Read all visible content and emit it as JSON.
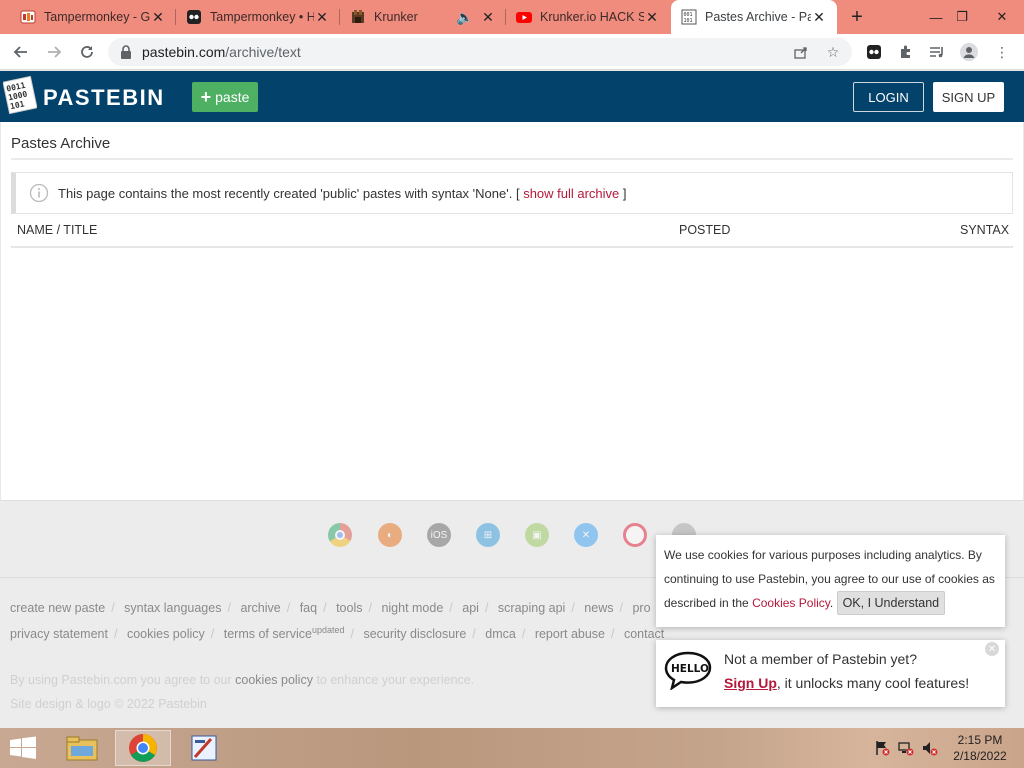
{
  "browser": {
    "tabs": [
      {
        "title": "Tampermonkey - G",
        "icon": "tampermonkey-icon",
        "active": false
      },
      {
        "title": "Tampermonkey • H",
        "icon": "tampermonkey-icon",
        "active": false
      },
      {
        "title": "Krunker",
        "icon": "krunker-icon",
        "active": false,
        "audio": true
      },
      {
        "title": "Krunker.io HACK S",
        "icon": "youtube-icon",
        "active": false
      },
      {
        "title": "Pastes Archive - Pa",
        "icon": "pastebin-icon",
        "active": true
      }
    ],
    "url_host": "pastebin.com",
    "url_path": "/archive/text"
  },
  "header": {
    "brand": "PASTEBIN",
    "paste_label": "paste",
    "login_label": "LOGIN",
    "signup_label": "SIGN UP"
  },
  "main": {
    "title": "Pastes Archive",
    "notice_text": "This page contains the most recently created 'public' pastes with syntax 'None'. [",
    "notice_link": "show full archive",
    "notice_end": "]",
    "columns": [
      "NAME / TITLE",
      "POSTED",
      "SYNTAX"
    ]
  },
  "footer": {
    "app_icons": [
      "chrome-icon",
      "firefox-icon",
      "ios-icon",
      "windows-icon",
      "android-icon",
      "mac-icon",
      "opera-icon",
      "other-icon"
    ],
    "links_row1": [
      "create new paste",
      "syntax languages",
      "archive",
      "faq",
      "tools",
      "night mode",
      "api",
      "scraping api",
      "news",
      "pro"
    ],
    "links_row2": [
      "privacy statement",
      "cookies policy",
      "terms of service",
      "security disclosure",
      "dmca",
      "report abuse",
      "contact"
    ],
    "tos_sup": "updated",
    "legal_prefix": "By using Pastebin.com you agree to our",
    "legal_link": "cookies policy",
    "legal_suffix": "to enhance your experience.",
    "copyright": "Site design & logo © 2022 Pastebin"
  },
  "cookie_popup": {
    "text": "We use cookies for various purposes including analytics. By continuing to use Pastebin, you agree to our use of cookies as described in the",
    "link": "Cookies Policy",
    "ok_label": "OK, I Understand"
  },
  "member_popup": {
    "line1": "Not a member of Pastebin yet?",
    "signup_link": "Sign Up",
    "line2_rest": ", it unlocks many cool features!"
  },
  "taskbar": {
    "time": "2:15 PM",
    "date": "2/18/2022"
  }
}
